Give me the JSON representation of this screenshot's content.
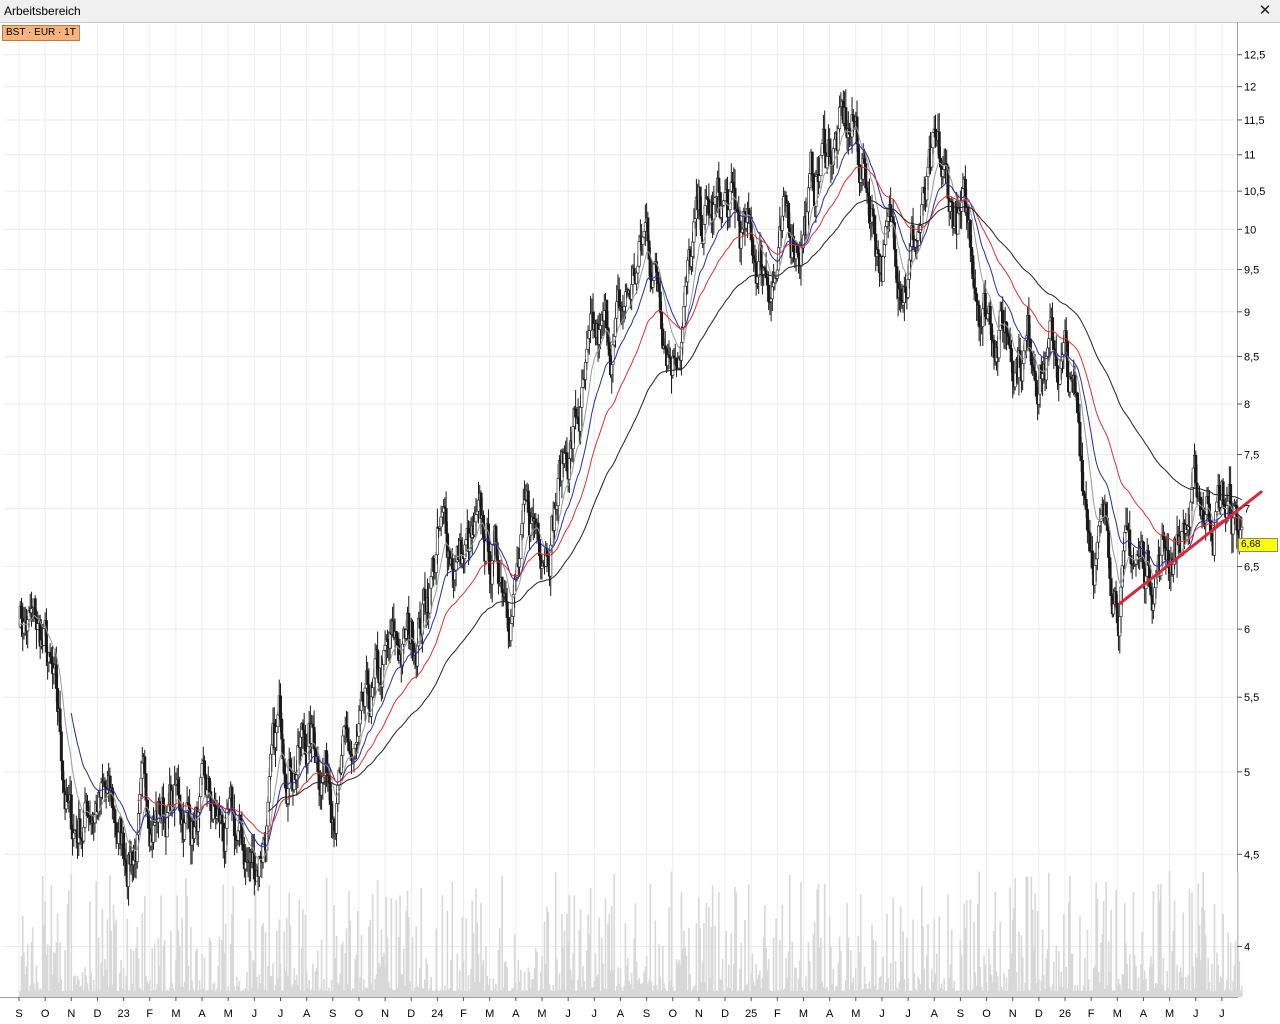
{
  "window": {
    "title": "Arbeitsbereich",
    "close_glyph": "✕"
  },
  "instrument_badge": "BST · EUR · 1T",
  "last_price_label": "6,68",
  "colors": {
    "candle_body": "#1a1a1a",
    "ma_short": "#9a9a9a",
    "ma_blue": "#2a2aa8",
    "ma_red": "#e03030",
    "ma_black": "#202020",
    "trendline": "#d42a3a",
    "volume": "#d8d8d8",
    "grid": "#ececec",
    "price_tag": "#ffff00"
  },
  "chart_data": {
    "type": "line",
    "scale": "log",
    "grid": true,
    "ylim": [
      3.75,
      13.0
    ],
    "y_ticks": [
      "4",
      "4,5",
      "5",
      "5,5",
      "6",
      "6,5",
      "7",
      "7,5",
      "8",
      "8,5",
      "9",
      "9,5",
      "10",
      "10,5",
      "11",
      "11,5",
      "12",
      "12,5"
    ],
    "y_tick_values": [
      4,
      4.5,
      5,
      5.5,
      6,
      6.5,
      7,
      7.5,
      8,
      8.5,
      9,
      9.5,
      10,
      10.5,
      11,
      11.5,
      12,
      12.5
    ],
    "x_ticks": [
      "S",
      "O",
      "N",
      "D",
      "23",
      "F",
      "M",
      "A",
      "M",
      "J",
      "J",
      "A",
      "S",
      "O",
      "N",
      "D",
      "24",
      "F",
      "M",
      "A",
      "M",
      "J",
      "J",
      "A",
      "S",
      "O",
      "N",
      "D",
      "25",
      "F",
      "M",
      "A",
      "M",
      "J",
      "J",
      "A",
      "S",
      "O",
      "N",
      "D",
      "26",
      "F",
      "M",
      "A",
      "M",
      "J",
      "J"
    ],
    "price_anchors": [
      [
        0,
        6.2
      ],
      [
        1,
        5.8
      ],
      [
        2,
        4.6
      ],
      [
        3,
        4.9
      ],
      [
        4,
        4.5
      ],
      [
        5,
        4.8
      ],
      [
        6,
        4.8
      ],
      [
        7,
        4.7
      ],
      [
        8,
        4.55
      ],
      [
        9,
        4.4
      ],
      [
        10,
        5.2
      ],
      [
        11,
        5.25
      ],
      [
        12,
        5.05
      ],
      [
        13,
        5.0
      ],
      [
        14,
        5.6
      ],
      [
        15,
        5.9
      ],
      [
        16,
        6.7
      ],
      [
        17,
        6.6
      ],
      [
        18,
        6.5
      ],
      [
        19,
        6.5
      ],
      [
        20,
        6.9
      ],
      [
        21,
        7.6
      ],
      [
        22,
        8.3
      ],
      [
        23,
        8.8
      ],
      [
        24,
        9.9
      ],
      [
        25,
        8.8
      ],
      [
        26,
        9.9
      ],
      [
        27,
        10.2
      ],
      [
        28,
        9.6
      ],
      [
        29,
        9.6
      ],
      [
        30,
        10.2
      ],
      [
        31,
        11.2
      ],
      [
        32,
        11.2
      ],
      [
        33,
        9.8
      ],
      [
        34,
        9.8
      ],
      [
        35,
        10.5
      ],
      [
        36,
        10.0
      ],
      [
        37,
        9.2
      ],
      [
        38,
        8.8
      ],
      [
        39,
        8.7
      ],
      [
        40,
        8.4
      ],
      [
        41,
        6.9
      ],
      [
        42,
        6.5
      ],
      [
        43,
        6.5
      ],
      [
        44,
        6.7
      ],
      [
        45,
        7.0
      ],
      [
        46,
        7.1
      ],
      [
        46.8,
        6.68
      ]
    ],
    "series": [
      {
        "name": "",
        "role": "ma-short",
        "lag": 0.7
      },
      {
        "name": "",
        "role": "ma-blue",
        "lag": 1.5,
        "start": 2
      },
      {
        "name": "",
        "role": "ma-red",
        "lag": 3.0,
        "start": 4.5
      },
      {
        "name": "",
        "role": "ma-black",
        "lag": 6.0,
        "start": 9.5
      }
    ],
    "trendline": {
      "from": [
        42.1,
        6.2
      ],
      "to": [
        47.5,
        7.15
      ]
    },
    "last_price": 6.68
  }
}
